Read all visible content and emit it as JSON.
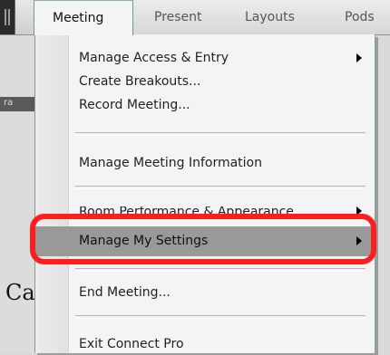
{
  "menubar": {
    "items": [
      "Meeting",
      "Present",
      "Layouts",
      "Pods"
    ]
  },
  "left_pane": {
    "strip_text": "ra",
    "text": "Ca"
  },
  "dropdown": {
    "items": [
      {
        "label": "Manage Access & Entry",
        "submenu": true
      },
      {
        "label": "Create Breakouts...",
        "submenu": false
      },
      {
        "label": "Record Meeting...",
        "submenu": false
      },
      {
        "label": "Manage Meeting Information",
        "submenu": false
      },
      {
        "label": "Room Performance & Appearance",
        "submenu": true
      },
      {
        "label": "Manage My Settings",
        "submenu": true,
        "highlighted": true
      },
      {
        "label": "End Meeting...",
        "submenu": false
      },
      {
        "label": "Exit Connect Pro",
        "submenu": false
      }
    ]
  },
  "annotation": {
    "color": "#ff1e1e"
  }
}
